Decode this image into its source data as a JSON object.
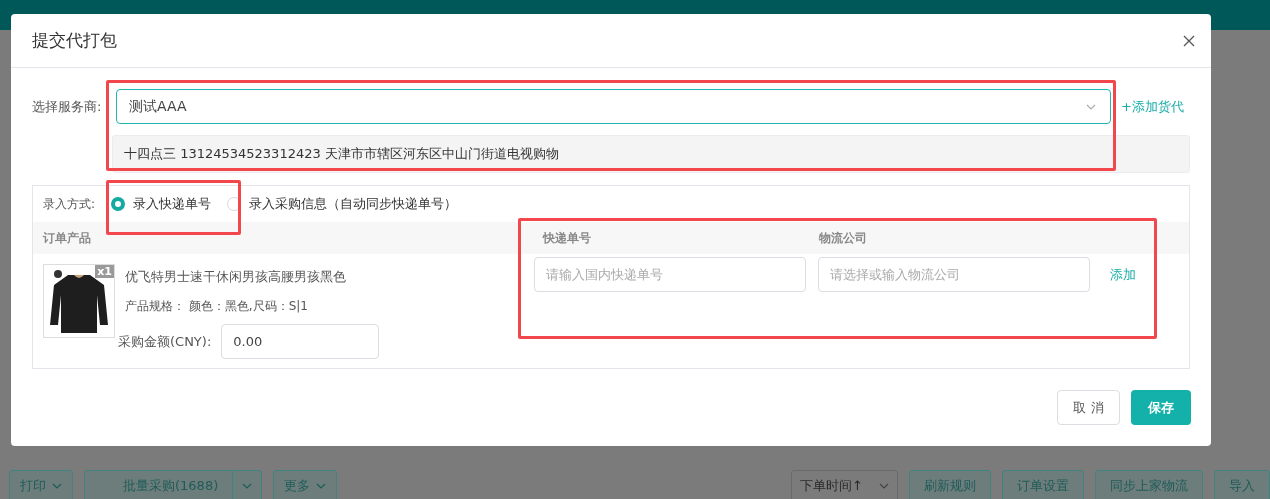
{
  "toolbar": {
    "left": [
      {
        "label": "打印",
        "kind": "dropdown"
      },
      {
        "label": "批量采购(1688)",
        "kind": "split"
      },
      {
        "label": "更多",
        "kind": "dropdown"
      }
    ],
    "sort": "下单时间↑",
    "right": [
      {
        "label": "刷新规则"
      },
      {
        "label": "订单设置"
      },
      {
        "label": "同步上家物流"
      },
      {
        "label": "导入"
      }
    ]
  },
  "dialog": {
    "title": "提交代打包",
    "provider_label": "选择服务商:",
    "provider_value": "测试AAA",
    "add_forwarder": "+添加货代",
    "address": "十四点三 13124534523312423 天津市市辖区河东区中山门街道电视购物",
    "mode_label": "录入方式:",
    "modes": [
      {
        "label": "录入快递单号",
        "selected": true
      },
      {
        "label": "录入采购信息（自动同步快递单号）",
        "selected": false
      }
    ],
    "columns": [
      "订单产品",
      "快递单号",
      "物流公司"
    ],
    "product": {
      "quantity": "x1",
      "title": "优飞特男士速干休闲男孩高腰男孩黑色",
      "spec_label": "产品规格：",
      "spec": "颜色：黑色,尺码：S|1",
      "amount_label": "采购金额(CNY):",
      "amount": "0.00"
    },
    "tracking_placeholder": "请输入国内快递单号",
    "carrier_placeholder": "请选择或输入物流公司",
    "add_link": "添加",
    "cancel": "取 消",
    "save": "保存"
  }
}
